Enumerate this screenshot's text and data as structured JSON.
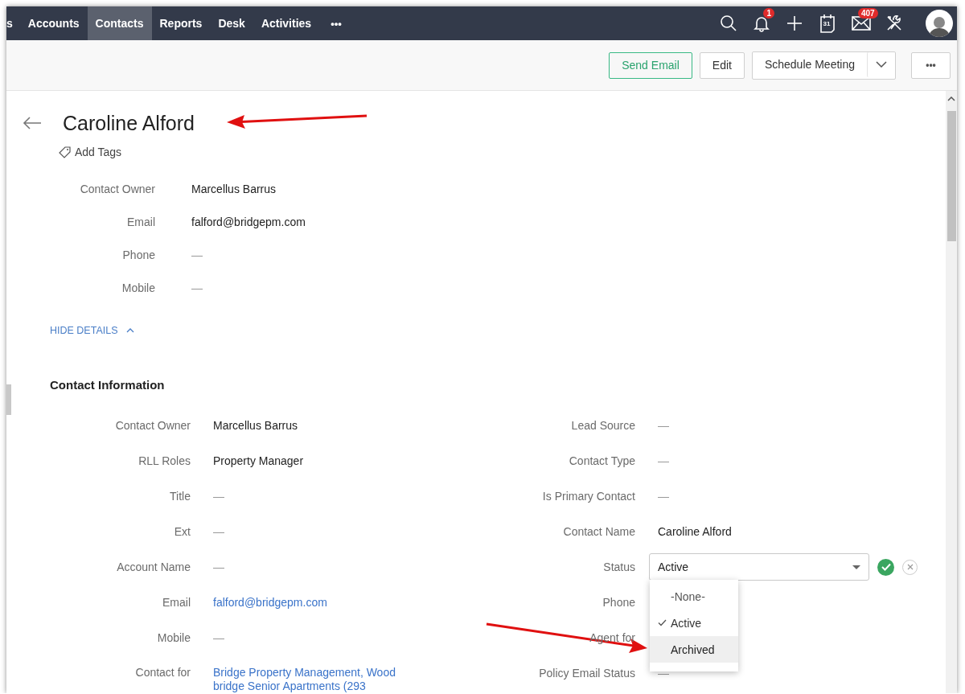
{
  "top_nav": {
    "tabs": [
      {
        "label": "s",
        "selected": false
      },
      {
        "label": "Accounts",
        "selected": false
      },
      {
        "label": "Contacts",
        "selected": true
      },
      {
        "label": "Reports",
        "selected": false
      },
      {
        "label": "Desk",
        "selected": false
      },
      {
        "label": "Activities",
        "selected": false
      }
    ],
    "more": "•••",
    "notifications_badge": "1",
    "calendar_day": "31",
    "mail_badge": "407"
  },
  "toolbar": {
    "buttons": [
      {
        "kind": "primary",
        "label": "Send Email"
      },
      {
        "kind": "plain",
        "label": "Edit"
      },
      {
        "kind": "split",
        "label": "Schedule Meeting"
      },
      {
        "kind": "more",
        "label": "•••"
      }
    ]
  },
  "record": {
    "title": "Caroline Alford",
    "add_tags": "Add Tags",
    "summary": [
      {
        "label": "Contact Owner",
        "kind": "text",
        "value": "Marcellus Barrus"
      },
      {
        "label": "Email",
        "kind": "text",
        "value": "falford@bridgepm.com"
      },
      {
        "label": "Phone",
        "kind": "empty",
        "value": "—"
      },
      {
        "label": "Mobile",
        "kind": "empty",
        "value": "—"
      }
    ],
    "hide_details": "HIDE DETAILS",
    "section": {
      "title": "Contact Information",
      "left": [
        {
          "label": "Contact Owner",
          "kind": "text",
          "value": "Marcellus Barrus"
        },
        {
          "label": "RLL Roles",
          "kind": "text",
          "value": "Property Manager"
        },
        {
          "label": "Title",
          "kind": "empty",
          "value": "—"
        },
        {
          "label": "Ext",
          "kind": "empty",
          "value": "—"
        },
        {
          "label": "Account Name",
          "kind": "empty",
          "value": "—"
        },
        {
          "label": "Email",
          "kind": "link",
          "value": "falford@bridgepm.com"
        },
        {
          "label": "Mobile",
          "kind": "empty",
          "value": "—"
        },
        {
          "label": "Contact for",
          "kind": "link",
          "value": "Bridge Property Management, Woodbridge Senior Apartments (293"
        }
      ],
      "right": [
        {
          "label": "Lead Source",
          "kind": "empty",
          "value": "—"
        },
        {
          "label": "Contact Type",
          "kind": "empty",
          "value": "—"
        },
        {
          "label": "Is Primary Contact",
          "kind": "empty",
          "value": "—"
        },
        {
          "label": "Contact Name",
          "kind": "text",
          "value": "Caroline Alford"
        },
        {
          "label": "Status",
          "kind": "select",
          "value": "Active",
          "open": true,
          "options": [
            {
              "label": "-None-",
              "selected": false,
              "highlighted": false
            },
            {
              "label": "Active",
              "selected": true,
              "highlighted": false
            },
            {
              "label": "Archived",
              "selected": false,
              "highlighted": true
            }
          ]
        },
        {
          "label": "Phone",
          "kind": "hidden"
        },
        {
          "label": "Agent for",
          "kind": "hidden"
        },
        {
          "label": "Policy Email Status",
          "kind": "empty",
          "value": "—"
        }
      ]
    }
  }
}
